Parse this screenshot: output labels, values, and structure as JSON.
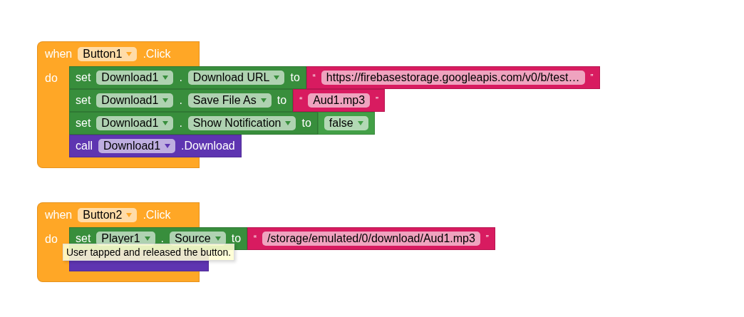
{
  "events": [
    {
      "keyword": "when",
      "component": "Button1",
      "event": ".Click",
      "do_label": "do",
      "statements": [
        {
          "kind": "set",
          "keyword": "set",
          "component": "Download1",
          "dot": ".",
          "property": "Download URL",
          "to": "to",
          "value": {
            "kind": "text",
            "open_quote": "“",
            "text": "https://firebasestorage.googleapis.com/v0/b/test…",
            "close_quote": "”"
          }
        },
        {
          "kind": "set",
          "keyword": "set",
          "component": "Download1",
          "dot": ".",
          "property": "Save File As",
          "to": "to",
          "value": {
            "kind": "text",
            "open_quote": "“",
            "text": "Aud1.mp3",
            "close_quote": "”"
          }
        },
        {
          "kind": "set",
          "keyword": "set",
          "component": "Download1",
          "dot": ".",
          "property": "Show Notification",
          "to": "to",
          "value": {
            "kind": "boolean",
            "text": "false"
          }
        },
        {
          "kind": "call",
          "keyword": "call",
          "component": "Download1",
          "method": ".Download"
        }
      ]
    },
    {
      "keyword": "when",
      "component": "Button2",
      "event": ".Click",
      "do_label": "do",
      "statements": [
        {
          "kind": "set",
          "keyword": "set",
          "component": "Player1",
          "dot": ".",
          "property": "Source",
          "to": "to",
          "value": {
            "kind": "text",
            "open_quote": "“",
            "text": "/storage/emulated/0/download/Aud1.mp3",
            "close_quote": "”"
          }
        },
        {
          "kind": "covered"
        }
      ]
    }
  ],
  "tooltip": {
    "text": "User tapped and released the button."
  }
}
